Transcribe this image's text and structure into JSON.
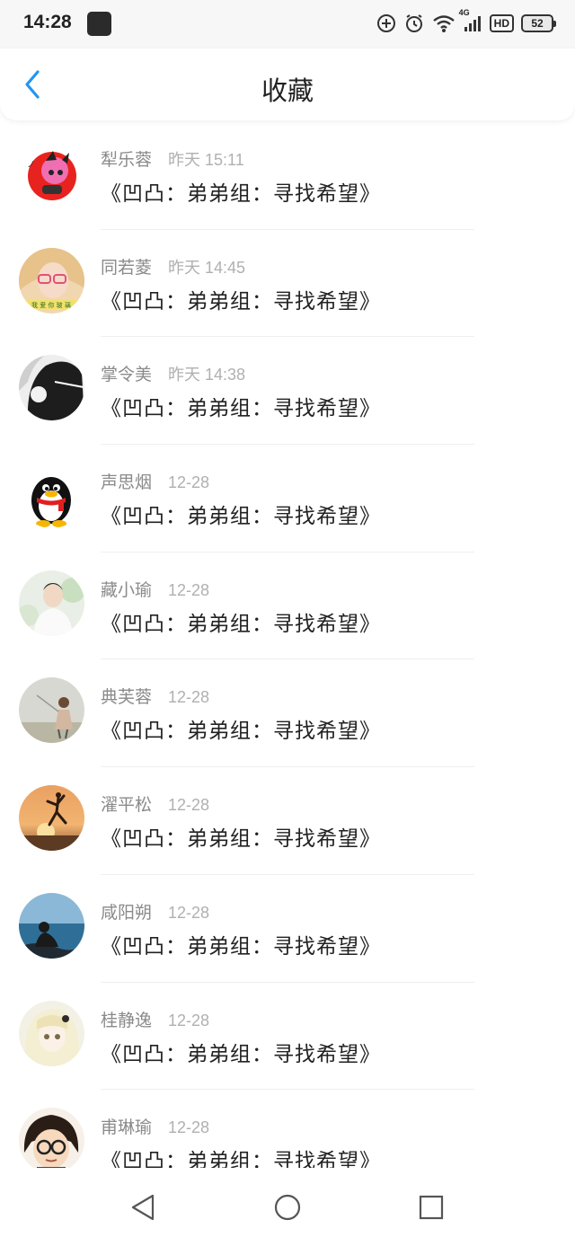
{
  "status_bar": {
    "time": "14:28",
    "network": "4G",
    "hd": "HD",
    "battery": "52"
  },
  "header": {
    "title": "收藏"
  },
  "items": [
    {
      "name": "犁乐蓉",
      "time": "昨天 15:11",
      "title": "《凹凸：弟弟组：寻找希望》"
    },
    {
      "name": "同若菱",
      "time": "昨天 14:45",
      "title": "《凹凸：弟弟组：寻找希望》"
    },
    {
      "name": "掌令美",
      "time": "昨天 14:38",
      "title": "《凹凸：弟弟组：寻找希望》"
    },
    {
      "name": "声思烟",
      "time": "12-28",
      "title": "《凹凸：弟弟组：寻找希望》"
    },
    {
      "name": "藏小瑜",
      "time": "12-28",
      "title": "《凹凸：弟弟组：寻找希望》"
    },
    {
      "name": "典芙蓉",
      "time": "12-28",
      "title": "《凹凸：弟弟组：寻找希望》"
    },
    {
      "name": "濯平松",
      "time": "12-28",
      "title": "《凹凸：弟弟组：寻找希望》"
    },
    {
      "name": "咸阳朔",
      "time": "12-28",
      "title": "《凹凸：弟弟组：寻找希望》"
    },
    {
      "name": "桂静逸",
      "time": "12-28",
      "title": "《凹凸：弟弟组：寻找希望》"
    },
    {
      "name": "甫琳瑜",
      "time": "12-28",
      "title": "《凹凸：弟弟组：寻找希望》"
    }
  ],
  "colors": {
    "accent": "#2196f3",
    "name_text": "#8a8a8a",
    "time_text": "#b0b0b0"
  }
}
